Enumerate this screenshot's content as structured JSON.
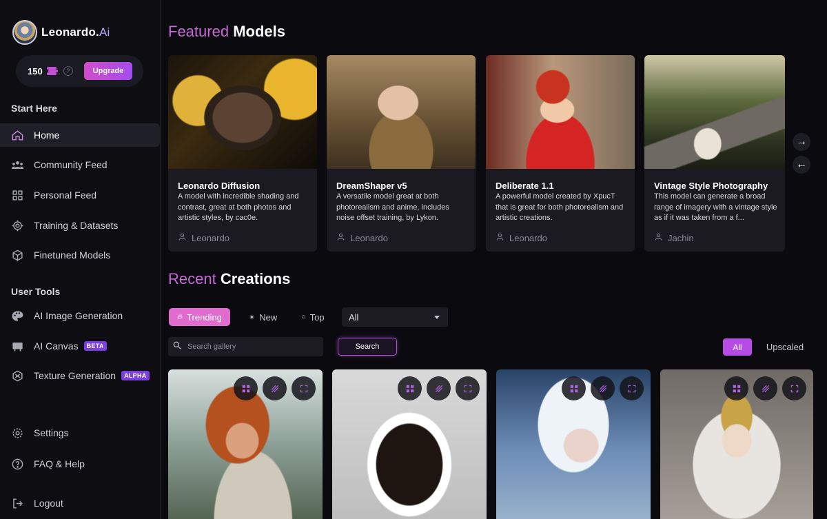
{
  "brand": {
    "name": "Leonardo.",
    "suffix": "Ai"
  },
  "credits": {
    "amount": "150",
    "help": "?",
    "upgrade_label": "Upgrade"
  },
  "sidebar": {
    "start_here_title": "Start Here",
    "start_items": [
      {
        "label": "Home",
        "icon": "home-icon"
      },
      {
        "label": "Community Feed",
        "icon": "community-icon"
      },
      {
        "label": "Personal Feed",
        "icon": "grid-icon"
      },
      {
        "label": "Training & Datasets",
        "icon": "training-icon"
      },
      {
        "label": "Finetuned Models",
        "icon": "cube-icon"
      }
    ],
    "user_tools_title": "User Tools",
    "tool_items": [
      {
        "label": "AI Image Generation",
        "icon": "palette-icon"
      },
      {
        "label": "AI Canvas",
        "icon": "canvas-icon",
        "badge": "BETA"
      },
      {
        "label": "Texture Generation",
        "icon": "texture-icon",
        "badge": "ALPHA"
      }
    ],
    "bottom_items": [
      {
        "label": "Settings",
        "icon": "gear-icon"
      },
      {
        "label": "FAQ & Help",
        "icon": "help-icon"
      },
      {
        "label": "Logout",
        "icon": "logout-icon"
      }
    ]
  },
  "featured": {
    "title_accent": "Featured",
    "title_rest": "Models",
    "models": [
      {
        "name": "Leonardo Diffusion",
        "description": "A model with incredible shading and contrast, great at both photos and artistic styles, by cac0e.",
        "author": "Leonardo"
      },
      {
        "name": "DreamShaper v5",
        "description": "A versatile model great at both photorealism and anime, includes noise offset training, by Lykon.",
        "author": "Leonardo"
      },
      {
        "name": "Deliberate 1.1",
        "description": "A powerful model created by XpucT that is great for both photorealism and artistic creations.",
        "author": "Leonardo"
      },
      {
        "name": "Vintage Style Photography",
        "description": "This model can generate a broad range of imagery with a vintage style as if it was taken from a f...",
        "author": "Jachin"
      }
    ],
    "next_arrow": "→",
    "prev_arrow": "←"
  },
  "recent": {
    "title_accent": "Recent",
    "title_rest": "Creations",
    "tabs": [
      {
        "label": "Trending"
      },
      {
        "label": "New"
      },
      {
        "label": "Top"
      }
    ],
    "select_value": "All",
    "search_placeholder": "Search gallery",
    "search_button": "Search",
    "filter_all": "All",
    "filter_upscaled": "Upscaled"
  },
  "colors": {
    "accent_pink": "#e26bd0",
    "accent_purple": "#b64be6",
    "background": "#0b0b0f"
  }
}
